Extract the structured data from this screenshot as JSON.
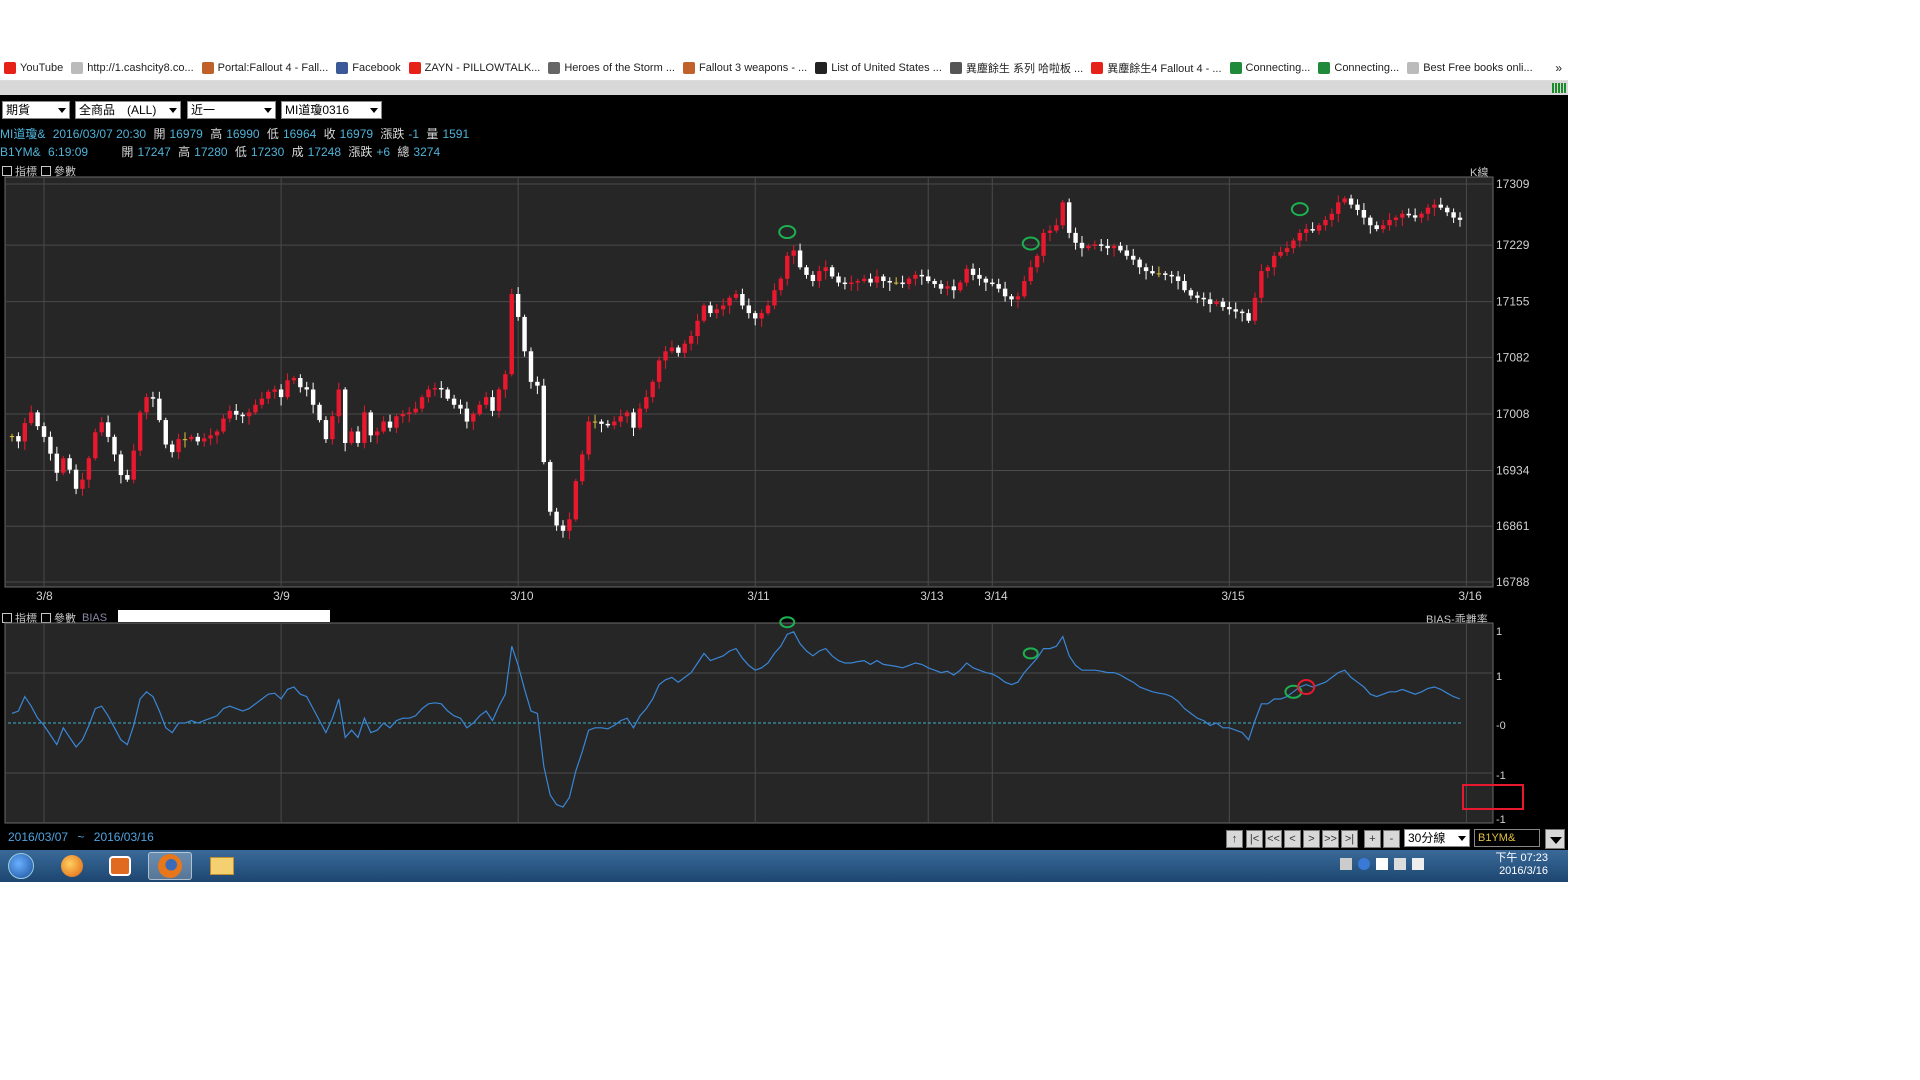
{
  "bookmarks": [
    {
      "label": "YouTube",
      "color": "#e62117",
      "icon": "youtube-icon"
    },
    {
      "label": "http://1.cashcity8.co...",
      "color": "#bbbbbb",
      "icon": "globe-icon"
    },
    {
      "label": "Portal:Fallout 4 - Fall...",
      "color": "#c0602a",
      "icon": "fallout-icon"
    },
    {
      "label": "Facebook",
      "color": "#3b5998",
      "icon": "facebook-icon"
    },
    {
      "label": "ZAYN - PILLOWTALK...",
      "color": "#e62117",
      "icon": "youtube-icon"
    },
    {
      "label": "Heroes of the Storm ...",
      "color": "#666666",
      "icon": "hots-icon"
    },
    {
      "label": "Fallout 3 weapons - ...",
      "color": "#c0602a",
      "icon": "fallout-icon"
    },
    {
      "label": "List of United States ...",
      "color": "#222222",
      "icon": "wikipedia-icon"
    },
    {
      "label": "異塵餘生 系列 哈啦板 ...",
      "color": "#555555",
      "icon": "bahamut-icon"
    },
    {
      "label": "異塵餘生4 Fallout 4 - ...",
      "color": "#e62117",
      "icon": "youtube-icon"
    },
    {
      "label": "Connecting...",
      "color": "#1e8a3a",
      "icon": "sheets-icon"
    },
    {
      "label": "Connecting...",
      "color": "#1e8a3a",
      "icon": "sheets-icon"
    },
    {
      "label": "Best Free books onli...",
      "color": "#bbbbbb",
      "icon": "globe-icon"
    }
  ],
  "bookmarks_more": "»",
  "toolbar": {
    "market": "期貨",
    "product": "全商品　(ALL)",
    "period": "近一",
    "contract": "MI道瓊0316"
  },
  "quote1": {
    "symbol": "MI道瓊&",
    "datetime": "2016/03/07 20:30",
    "open_lbl": "開",
    "open": "16979",
    "high_lbl": "高",
    "high": "16990",
    "low_lbl": "低",
    "low": "16964",
    "close_lbl": "收",
    "close": "16979",
    "chg_lbl": "漲跌",
    "chg": "-1",
    "vol_lbl": "量",
    "vol": "1591"
  },
  "quote2": {
    "symbol": "B1YM&",
    "time": "6:19:09",
    "open_lbl": "開",
    "open": "17247",
    "high_lbl": "高",
    "high": "17280",
    "low_lbl": "低",
    "low": "17230",
    "close_lbl": "成",
    "close": "17248",
    "chg_lbl": "漲跌",
    "chg": "+6",
    "vol_lbl": "總",
    "vol": "3274"
  },
  "panel_header": {
    "indicator": "指標",
    "params": "參數"
  },
  "kline_label": "K線",
  "bias_label": "BIAS",
  "bias_right_label": "BIAS-乖離率",
  "colors": {
    "up": "#e8182e",
    "down": "#ffffff",
    "doji": "#e0c040",
    "bias_line": "#3a86d6",
    "zero_line": "#3ab0d0",
    "marker_green": "#1db050",
    "marker_red": "#e8182e"
  },
  "chart_data": [
    {
      "type": "candlestick",
      "title": "K線",
      "ylim": [
        16788,
        17309
      ],
      "y_ticks": [
        "17309",
        "17229",
        "17155",
        "17082",
        "17008",
        "16934",
        "16861",
        "16788"
      ],
      "x_ticks": [
        {
          "label": "3/8",
          "index": 5
        },
        {
          "label": "3/9",
          "index": 42
        },
        {
          "label": "3/10",
          "index": 79
        },
        {
          "label": "3/11",
          "index": 116
        },
        {
          "label": "3/13",
          "index": 143
        },
        {
          "label": "3/14",
          "index": 153
        },
        {
          "label": "3/15",
          "index": 190
        },
        {
          "label": "3/16",
          "index": 227
        }
      ],
      "close": [
        16979,
        16972,
        16996,
        17010,
        16992,
        16978,
        16956,
        16931,
        16950,
        16935,
        16910,
        16922,
        16950,
        16984,
        16997,
        16978,
        16955,
        16928,
        16922,
        16960,
        17010,
        17030,
        17028,
        17000,
        16968,
        16958,
        16975,
        16975,
        16978,
        16972,
        16976,
        16980,
        16985,
        17002,
        17012,
        17007,
        17005,
        17010,
        17020,
        17028,
        17037,
        17040,
        17030,
        17052,
        17055,
        17043,
        17040,
        17020,
        17000,
        16975,
        17005,
        17040,
        16970,
        16985,
        16970,
        17010,
        16980,
        16985,
        16998,
        16990,
        17005,
        17008,
        17010,
        17015,
        17030,
        17040,
        17042,
        17040,
        17028,
        17020,
        17015,
        16998,
        17008,
        17020,
        17030,
        17012,
        17040,
        17060,
        17165,
        17135,
        17090,
        17050,
        17045,
        16945,
        16880,
        16862,
        16855,
        16870,
        16920,
        16955,
        16998,
        16998,
        16995,
        16993,
        16998,
        17005,
        17010,
        16990,
        17015,
        17030,
        17050,
        17078,
        17090,
        17095,
        17088,
        17100,
        17110,
        17130,
        17150,
        17140,
        17145,
        17150,
        17160,
        17165,
        17150,
        17140,
        17133,
        17140,
        17150,
        17170,
        17185,
        17215,
        17222,
        17200,
        17190,
        17182,
        17195,
        17200,
        17188,
        17180,
        17178,
        17180,
        17182,
        17185,
        17180,
        17188,
        17182,
        17180,
        17180,
        17178,
        17185,
        17190,
        17188,
        17182,
        17178,
        17172,
        17175,
        17170,
        17180,
        17198,
        17190,
        17185,
        17180,
        17178,
        17172,
        17162,
        17158,
        17162,
        17182,
        17200,
        17215,
        17245,
        17248,
        17255,
        17285,
        17245,
        17232,
        17225,
        17228,
        17230,
        17228,
        17225,
        17228,
        17222,
        17215,
        17210,
        17200,
        17195,
        17192,
        17192,
        17190,
        17188,
        17182,
        17170,
        17163,
        17160,
        17158,
        17152,
        17155,
        17148,
        17145,
        17142,
        17140,
        17130,
        17160,
        17195,
        17200,
        17215,
        17220,
        17225,
        17235,
        17245,
        17250,
        17248,
        17255,
        17262,
        17270,
        17285,
        17290,
        17282,
        17275,
        17265,
        17255,
        17250,
        17255,
        17262,
        17265,
        17270,
        17268,
        17265,
        17270,
        17278,
        17282,
        17278,
        17272,
        17265,
        17262
      ]
    },
    {
      "type": "line",
      "title": "BIAS",
      "y_ticks": [
        "1",
        "1",
        "-0",
        "-1",
        "-1"
      ],
      "ylim": [
        -2,
        2
      ],
      "zero_line": 0,
      "series": [
        {
          "values": [
            0.2,
            0.25,
            0.55,
            0.35,
            0.1,
            -0.05,
            -0.25,
            -0.45,
            -0.1,
            -0.3,
            -0.5,
            -0.35,
            -0.05,
            0.3,
            0.35,
            0.15,
            -0.1,
            -0.35,
            -0.45,
            -0.05,
            0.5,
            0.65,
            0.55,
            0.25,
            -0.1,
            -0.2,
            0.0,
            0.0,
            0.05,
            0.0,
            0.05,
            0.1,
            0.15,
            0.3,
            0.35,
            0.3,
            0.25,
            0.3,
            0.4,
            0.5,
            0.6,
            0.62,
            0.5,
            0.7,
            0.75,
            0.6,
            0.55,
            0.3,
            0.05,
            -0.2,
            0.1,
            0.5,
            -0.3,
            -0.15,
            -0.3,
            0.1,
            -0.2,
            -0.15,
            0.0,
            -0.1,
            0.05,
            0.1,
            0.1,
            0.15,
            0.3,
            0.4,
            0.42,
            0.4,
            0.25,
            0.15,
            0.1,
            -0.1,
            0.0,
            0.15,
            0.25,
            0.05,
            0.35,
            0.6,
            1.6,
            1.2,
            0.7,
            0.25,
            0.2,
            -0.9,
            -1.5,
            -1.7,
            -1.75,
            -1.55,
            -1.0,
            -0.6,
            -0.15,
            -0.1,
            -0.1,
            -0.12,
            -0.05,
            0.05,
            0.1,
            -0.1,
            0.15,
            0.3,
            0.5,
            0.8,
            0.9,
            0.95,
            0.85,
            0.95,
            1.05,
            1.25,
            1.45,
            1.3,
            1.35,
            1.4,
            1.5,
            1.55,
            1.35,
            1.2,
            1.1,
            1.15,
            1.25,
            1.45,
            1.6,
            1.85,
            1.9,
            1.65,
            1.5,
            1.4,
            1.5,
            1.55,
            1.4,
            1.3,
            1.25,
            1.25,
            1.28,
            1.3,
            1.22,
            1.3,
            1.22,
            1.2,
            1.18,
            1.15,
            1.2,
            1.25,
            1.22,
            1.15,
            1.1,
            1.05,
            1.08,
            1.0,
            1.1,
            1.25,
            1.15,
            1.1,
            1.05,
            1.02,
            0.95,
            0.85,
            0.8,
            0.85,
            1.05,
            1.2,
            1.35,
            1.55,
            1.55,
            1.6,
            1.8,
            1.4,
            1.2,
            1.1,
            1.1,
            1.1,
            1.08,
            1.05,
            1.05,
            1.0,
            0.92,
            0.85,
            0.75,
            0.7,
            0.65,
            0.62,
            0.6,
            0.55,
            0.45,
            0.3,
            0.2,
            0.1,
            0.05,
            -0.05,
            0.0,
            -0.1,
            -0.1,
            -0.15,
            -0.2,
            -0.35,
            0.05,
            0.4,
            0.4,
            0.5,
            0.5,
            0.55,
            0.65,
            0.75,
            0.8,
            0.75,
            0.8,
            0.85,
            0.95,
            1.05,
            1.1,
            0.95,
            0.85,
            0.75,
            0.6,
            0.55,
            0.6,
            0.65,
            0.65,
            0.7,
            0.65,
            0.6,
            0.65,
            0.72,
            0.75,
            0.7,
            0.62,
            0.55,
            0.5
          ]
        }
      ]
    }
  ],
  "date_range": {
    "start": "2016/03/07",
    "sep": "~",
    "end": "2016/03/16"
  },
  "nav": {
    "timeframe": "30分線",
    "symbol_box": "B1YM&"
  },
  "nav_buttons": [
    "↑",
    "|<",
    "<<",
    "<",
    ">",
    ">>",
    ">|",
    "+",
    "-"
  ],
  "clock": {
    "time": "下午 07:23",
    "date": "2016/3/16"
  }
}
